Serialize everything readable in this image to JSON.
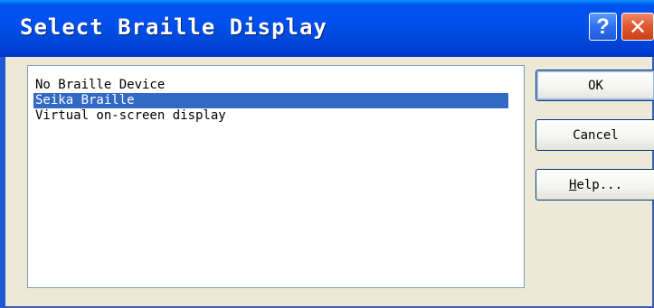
{
  "window": {
    "title": "Select Braille Display",
    "help_button_glyph": "?",
    "close_button_glyph": "✕"
  },
  "list": {
    "items": [
      {
        "label": "No Braille Device",
        "selected": false
      },
      {
        "label": "Seika Braille",
        "selected": true
      },
      {
        "label": "Virtual on-screen display",
        "selected": false
      }
    ]
  },
  "buttons": {
    "ok_label": "OK",
    "cancel_label": "Cancel",
    "help_mnemonic": "H",
    "help_rest": "elp..."
  },
  "colors": {
    "titlebar": "#0050ee",
    "selection": "#316ac5",
    "dialog_face": "#ece9d8",
    "close_button": "#e0552a"
  }
}
